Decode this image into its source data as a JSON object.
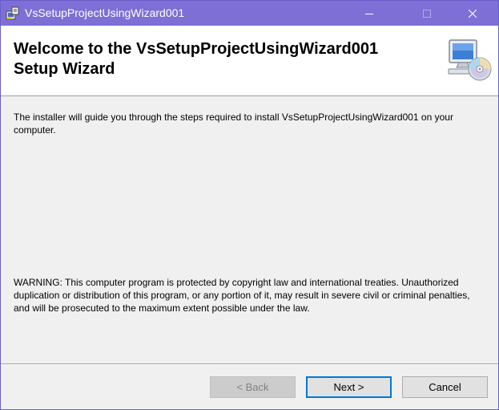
{
  "window": {
    "title": "VsSetupProjectUsingWizard001",
    "app_icon": "installer-app-icon",
    "controls": {
      "minimize_icon": "minimize-icon",
      "maximize_icon": "maximize-icon",
      "close_icon": "close-icon"
    }
  },
  "header": {
    "title_line1": "Welcome to the VsSetupProjectUsingWizard001",
    "title_line2": "Setup Wizard",
    "icon": "computer-cd-icon"
  },
  "content": {
    "intro": "The installer will guide you through the steps required to install VsSetupProjectUsingWizard001 on your computer.",
    "warning": "WARNING: This computer program is protected by copyright law and international treaties. Unauthorized duplication or distribution of this program, or any portion of it, may result in severe civil or criminal penalties, and will be prosecuted to the maximum extent possible under the law."
  },
  "buttons": {
    "back_label": "< Back",
    "next_label": "Next >",
    "cancel_label": "Cancel"
  },
  "colors": {
    "titlebar": "#7e6fd6",
    "window_bg": "#f0f0f0",
    "header_bg": "#ffffff",
    "focus_border": "#0078d7"
  }
}
